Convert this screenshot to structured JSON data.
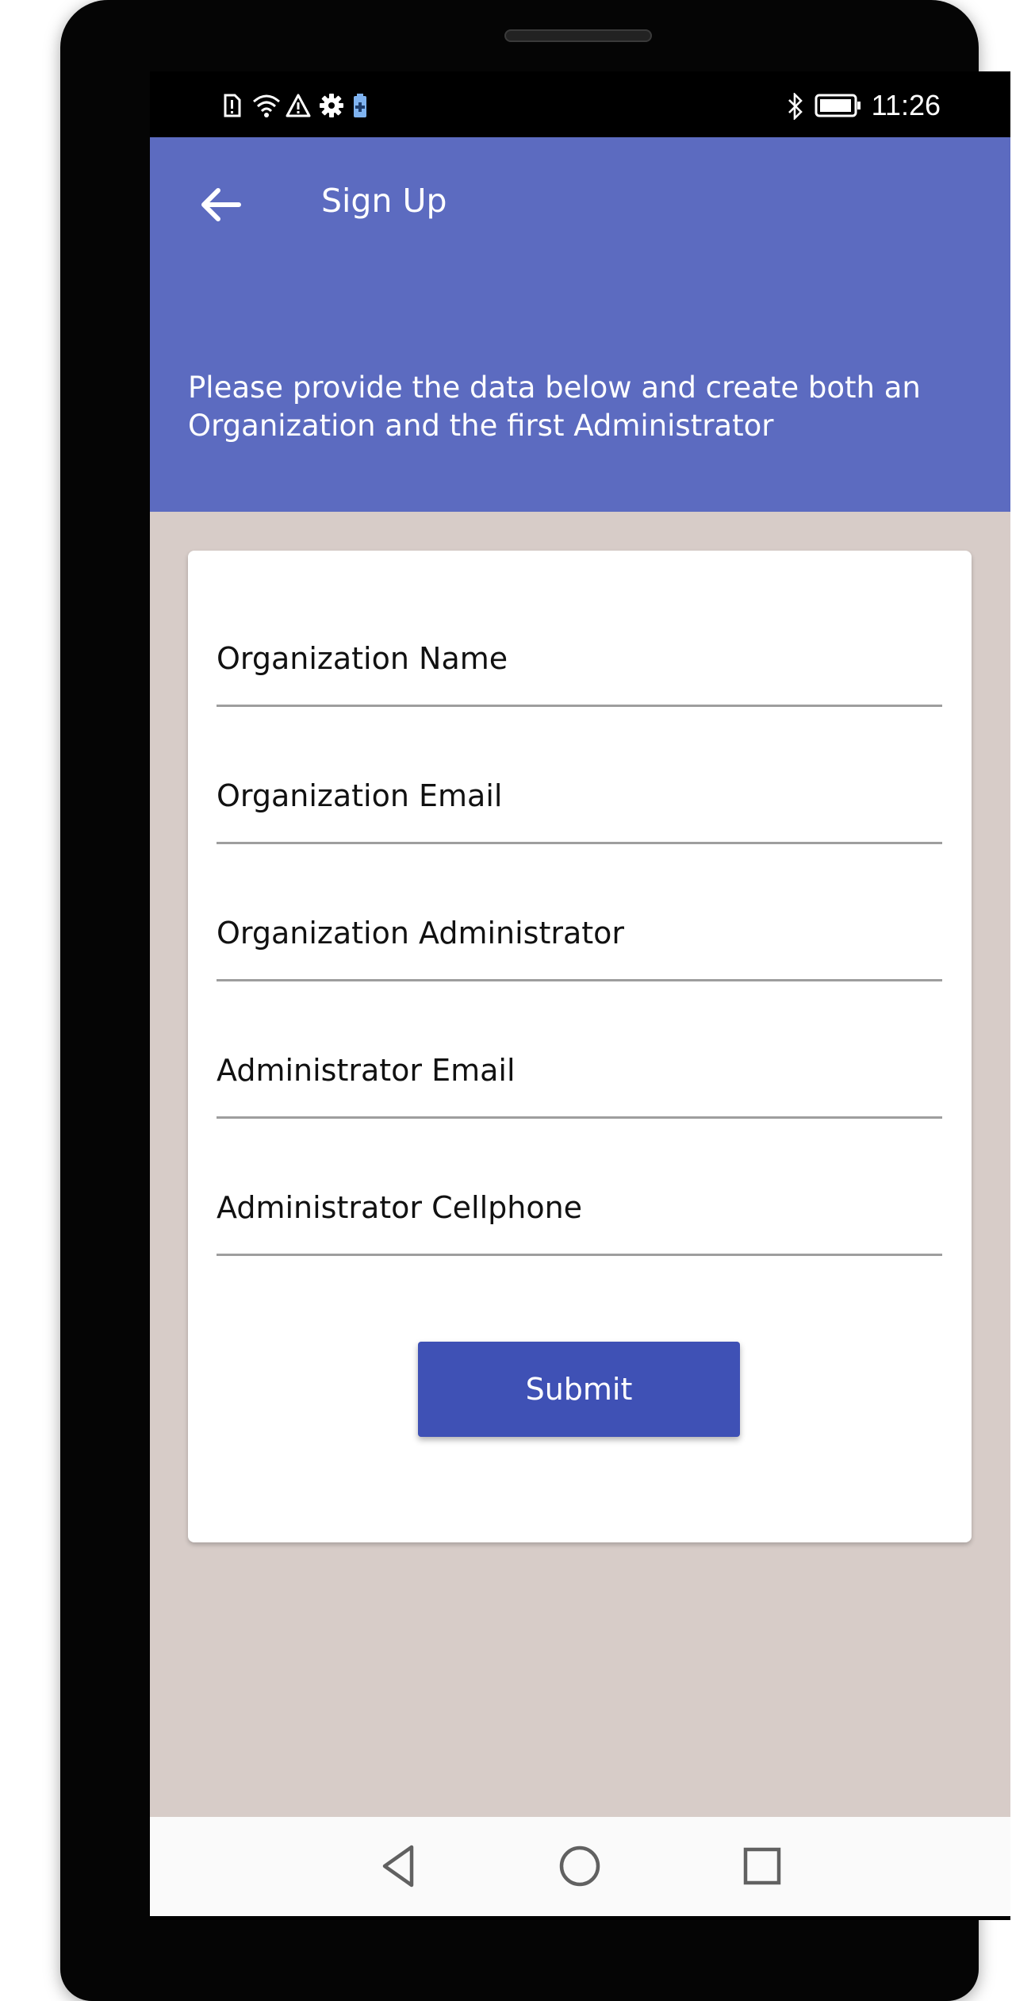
{
  "statusbar": {
    "left_icons": [
      "sim-alert-icon",
      "wifi-icon",
      "warning-icon",
      "settings-icon",
      "battery-saver-icon"
    ],
    "right_icons": [
      "bluetooth-icon",
      "battery-icon"
    ],
    "time": "11:26"
  },
  "appbar": {
    "back_icon": "arrow-back-icon",
    "title": "Sign Up",
    "subtitle": "Please provide the data below and create both an Organization and the first Administrator",
    "color": "#5c6bc0"
  },
  "form": {
    "fields": [
      {
        "placeholder": "Organization Name",
        "value": ""
      },
      {
        "placeholder": "Organization Email",
        "value": ""
      },
      {
        "placeholder": "Organization Administrator",
        "value": ""
      },
      {
        "placeholder": "Administrator Email",
        "value": ""
      },
      {
        "placeholder": "Administrator Cellphone",
        "value": ""
      }
    ],
    "submit_label": "Submit",
    "submit_color": "#3f51b5"
  },
  "background_color": "#d7ccc8",
  "navbar": {
    "items": [
      "back-triangle-icon",
      "home-circle-icon",
      "recents-square-icon"
    ]
  }
}
